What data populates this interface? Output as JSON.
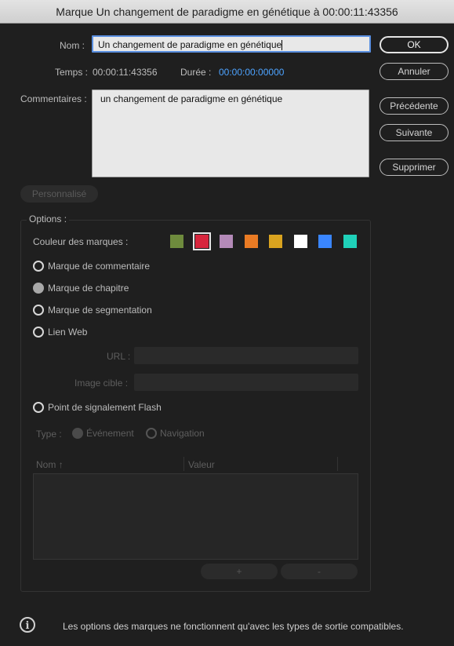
{
  "window": {
    "title": "Marque Un changement de paradigme en génétique à 00:00:11:43356"
  },
  "name_field": {
    "label": "Nom :",
    "value": "Un changement de paradigme en génétique"
  },
  "time": {
    "label": "Temps :",
    "value": "00:00:11:43356"
  },
  "duration": {
    "label": "Durée :",
    "value": "00:00:00:00000",
    "color": "#4da3ff"
  },
  "comments": {
    "label": "Commentaires :",
    "value": "un changement de paradigme en génétique"
  },
  "buttons": {
    "ok": "OK",
    "cancel": "Annuler",
    "previous": "Précédente",
    "next": "Suivante",
    "delete": "Supprimer",
    "custom": "Personnalisé"
  },
  "options": {
    "legend": "Options :",
    "color_label": "Couleur des marques :",
    "colors": [
      "#6e8b3d",
      "#d7263d",
      "#b48ab8",
      "#ea7b24",
      "#d9a31f",
      "#ffffff",
      "#3a86ff",
      "#1fd1b9"
    ],
    "selected_color_index": 1,
    "marker_types": [
      {
        "label": "Marque de commentaire",
        "selected": false
      },
      {
        "label": "Marque de chapitre",
        "selected": true
      },
      {
        "label": "Marque de segmentation",
        "selected": false
      },
      {
        "label": "Lien Web",
        "selected": false
      }
    ],
    "url_label": "URL :",
    "url_value": "",
    "target_label": "Image cible :",
    "target_value": "",
    "flash_label": "Point de signalement Flash",
    "type_label": "Type :",
    "type_event": "Événement",
    "type_navigation": "Navigation",
    "table": {
      "col_name": "Nom",
      "col_value": "Valeur",
      "sort_icon": "arrow-up-icon"
    },
    "add": "+",
    "remove": "-"
  },
  "footer": {
    "note": "Les options des marques ne fonctionnent qu'avec les types de sortie compatibles."
  }
}
